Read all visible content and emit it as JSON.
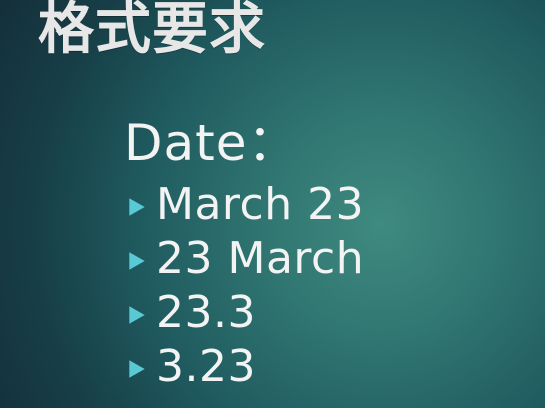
{
  "slide": {
    "title": "格式要求",
    "section_label": "Date：",
    "items": [
      {
        "label": "March 23"
      },
      {
        "label": "23 March"
      },
      {
        "label": "23.3"
      },
      {
        "label": "3.23"
      }
    ],
    "colors": {
      "accent_bullet": "#59c9d6",
      "text": "#f3f3f3"
    },
    "icons": {
      "bullet": "right-triangle-icon"
    }
  }
}
